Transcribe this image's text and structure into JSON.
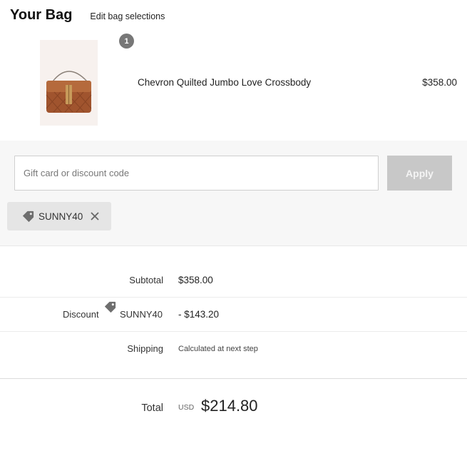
{
  "header": {
    "title": "Your Bag",
    "edit_link": "Edit bag selections"
  },
  "item": {
    "quantity": "1",
    "name": "Chevron Quilted Jumbo Love Crossbody",
    "price": "$358.00",
    "image_icon": "crossbody-bag-image"
  },
  "discount_form": {
    "placeholder": "Gift card or discount code",
    "value": "",
    "apply_label": "Apply",
    "applied_code": "SUNNY40",
    "tag_icon": "tag-icon",
    "remove_icon": "close-icon"
  },
  "summary": {
    "subtotal_label": "Subtotal",
    "subtotal_value": "$358.00",
    "discount_label": "Discount",
    "discount_code": "SUNNY40",
    "discount_value": "- $143.20",
    "shipping_label": "Shipping",
    "shipping_value": "Calculated at next step",
    "total_label": "Total",
    "total_currency": "USD",
    "total_value": "$214.80"
  },
  "colors": {
    "panel_bg": "#f7f7f7",
    "apply_bg": "#c8c8c8",
    "chip_bg": "#e5e5e5",
    "badge_bg": "#777777",
    "bag_brown": "#a0542e"
  }
}
